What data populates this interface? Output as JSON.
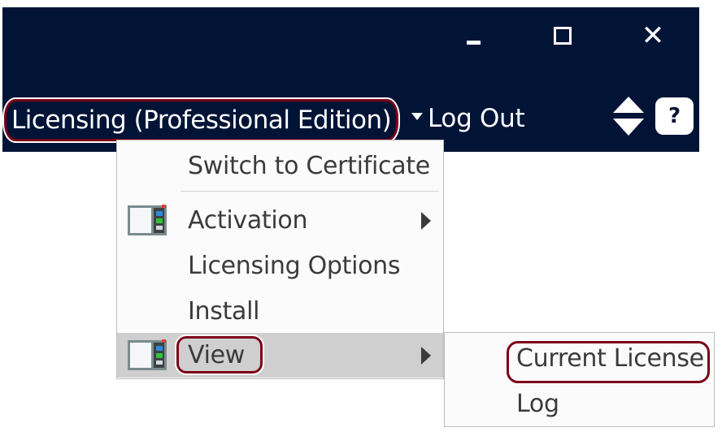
{
  "window": {
    "controls": {
      "minimize": "minimize",
      "maximize": "maximize",
      "close": "✕"
    }
  },
  "header": {
    "menu_title": "Licensing (Professional Edition)",
    "logout_label": "Log Out",
    "help_label": "?"
  },
  "menu": {
    "items": [
      {
        "label": "Switch to Certificate",
        "icon": null,
        "submenu": false
      },
      {
        "label": "Activation",
        "icon": "app-window-icon",
        "submenu": true
      },
      {
        "label": "Licensing Options",
        "icon": null,
        "submenu": false
      },
      {
        "label": "Install",
        "icon": null,
        "submenu": false
      },
      {
        "label": "View",
        "icon": "app-window-icon",
        "submenu": true,
        "active": true
      }
    ]
  },
  "submenu": {
    "items": [
      {
        "label": "Current License",
        "highlighted": true
      },
      {
        "label": "Log"
      }
    ]
  },
  "colors": {
    "titlebar": "#011436",
    "annotation": "#7b0018",
    "active_row": "#cfcfcf",
    "text": "#3b3b3b"
  }
}
